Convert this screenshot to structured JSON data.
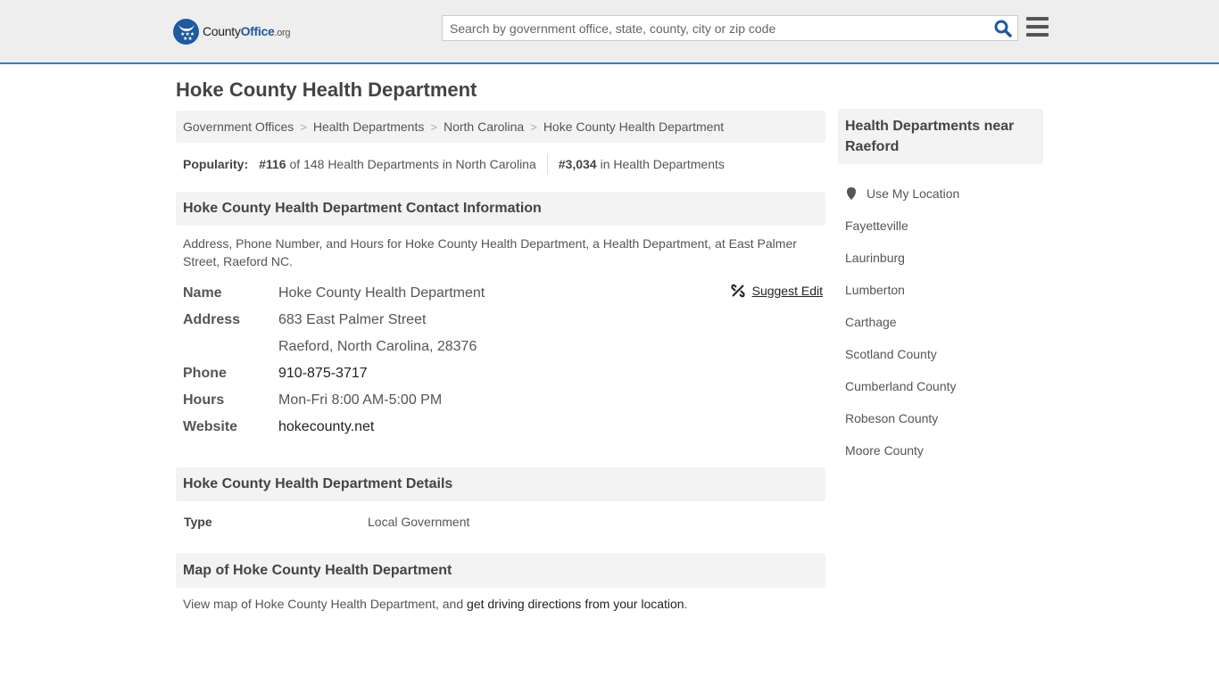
{
  "header": {
    "logo": {
      "county": "County",
      "office": "Office",
      "org": ".org"
    },
    "search_placeholder": "Search by government office, state, county, city or zip code",
    "search_value": ""
  },
  "page_title": "Hoke County Health Department",
  "breadcrumb": [
    "Government Offices",
    "Health Departments",
    "North Carolina",
    "Hoke County Health Department"
  ],
  "popularity": {
    "label": "Popularity:",
    "state_rank": "#116",
    "state_text": "of 148 Health Departments in North Carolina",
    "national_rank": "#3,034",
    "national_text": "in Health Departments"
  },
  "contact_section": {
    "title": "Hoke County Health Department Contact Information",
    "description": "Address, Phone Number, and Hours for Hoke County Health Department, a Health Department, at East Palmer Street, Raeford NC.",
    "suggest_edit": "Suggest Edit",
    "fields": {
      "name_label": "Name",
      "name": "Hoke County Health Department",
      "address_label": "Address",
      "address_line1": "683 East Palmer Street",
      "address_line2": "Raeford, North Carolina, 28376",
      "phone_label": "Phone",
      "phone": "910-875-3717",
      "hours_label": "Hours",
      "hours": "Mon-Fri 8:00 AM-5:00 PM",
      "website_label": "Website",
      "website": "hokecounty.net"
    }
  },
  "details_section": {
    "title": "Hoke County Health Department Details",
    "type_label": "Type",
    "type_value": "Local Government"
  },
  "map_section": {
    "title": "Map of Hoke County Health Department",
    "text_prefix": "View map of Hoke County Health Department, and ",
    "link": "get driving directions from your location",
    "text_suffix": "."
  },
  "sidebar": {
    "title": "Health Departments near Raeford",
    "use_location": "Use My Location",
    "items": [
      "Fayetteville",
      "Laurinburg",
      "Lumberton",
      "Carthage",
      "Scotland County",
      "Cumberland County",
      "Robeson County",
      "Moore County"
    ]
  },
  "colors": {
    "brand_blue": "#1e5aa0",
    "header_border": "#3d7fb9",
    "panel_bg": "#f3f3f3"
  }
}
